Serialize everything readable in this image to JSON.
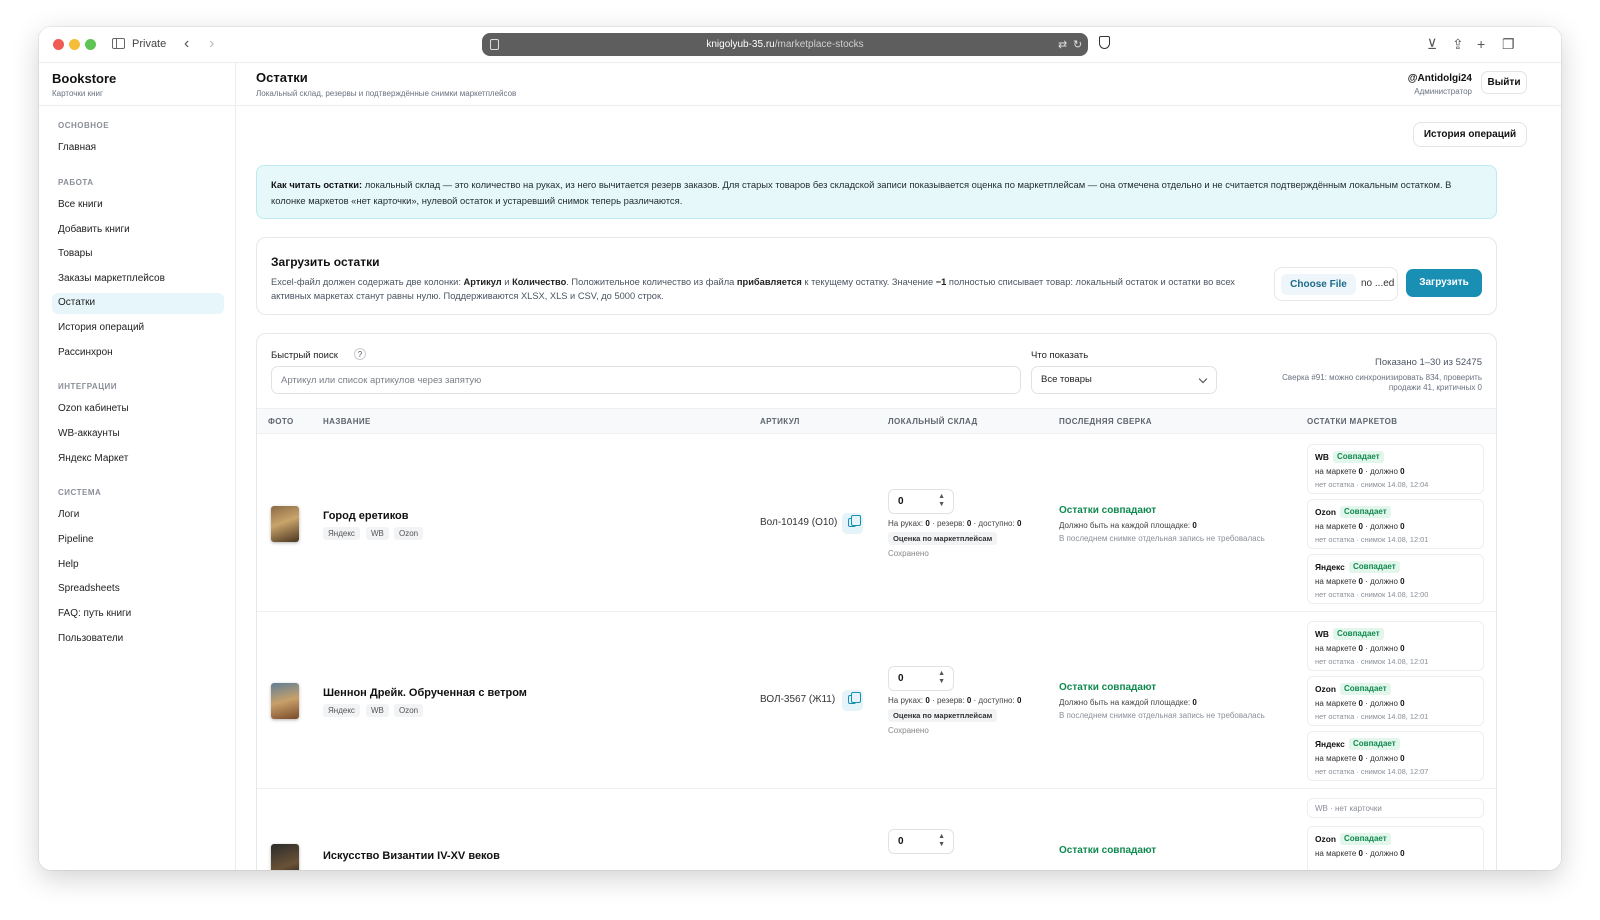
{
  "browser": {
    "private_label": "Private",
    "url_host": "knigolyub-35.ru",
    "url_path": "/marketplace-stocks"
  },
  "sidebar": {
    "brand": "Bookstore",
    "brand_sub": "Карточки книг",
    "sections": [
      {
        "title": "ОСНОВНОЕ",
        "items": [
          "Главная"
        ]
      },
      {
        "title": "РАБОТА",
        "items": [
          "Все книги",
          "Добавить книги",
          "Товары",
          "Заказы маркетплейсов",
          "Остатки",
          "История операций",
          "Рассинхрон"
        ]
      },
      {
        "title": "ИНТЕГРАЦИИ",
        "items": [
          "Ozon кабинеты",
          "WB-аккаунты",
          "Яндекс Маркет"
        ]
      },
      {
        "title": "СИСТЕМА",
        "items": [
          "Логи",
          "Pipeline",
          "Help",
          "Spreadsheets",
          "FAQ: путь книги",
          "Пользователи"
        ]
      }
    ],
    "active_item": "Остатки"
  },
  "header": {
    "title": "Остатки",
    "subtitle": "Локальный склад, резервы и подтверждённые снимки маркетплейсов",
    "user_name": "@Antidolgi24",
    "user_role": "Администратор",
    "logout_label": "Выйти",
    "history_label": "История операций"
  },
  "info": {
    "lead": "Как читать остатки:",
    "text": " локальный склад — это количество на руках, из него вычитается резерв заказов. Для старых товаров без складской записи показывается оценка по маркетплейсам — она отмечена отдельно и не считается подтверждённым локальным остатком. В колонке маркетов «нет карточки», нулевой остаток и устаревший снимок теперь различаются."
  },
  "upload": {
    "title": "Загрузить остатки",
    "desc_parts": [
      "Excel-файл должен содержать две колонки: ",
      "Артикул",
      " и ",
      "Количество",
      ". Положительное количество из файла ",
      "прибавляется",
      " к текущему остатку. Значение ",
      "−1",
      " полностью списывает товар: локальный остаток и остатки во всех активных маркетах станут равны нулю. Поддерживаются XLSX, XLS и CSV, до 5000 строк."
    ],
    "choose_file": "Choose File",
    "file_name": "no ...ed",
    "upload_label": "Загрузить"
  },
  "filters": {
    "search_label": "Быстрый поиск",
    "help": "?",
    "search_placeholder": "Артикул или список артикулов через запятую",
    "show_label": "Что показать",
    "show_value": "Все товары",
    "shown_count": "Показано 1–30 из 52475",
    "sync_note": "Сверка #91: можно синхронизировать 834, проверить продажи 41, критичных 0"
  },
  "table": {
    "columns": [
      "ФОТО",
      "НАЗВАНИЕ",
      "АРТИКУЛ",
      "ЛОКАЛЬНЫЙ СКЛАД",
      "ПОСЛЕДНЯЯ СВЕРКА",
      "ОСТАТКИ МАРКЕТОВ"
    ],
    "rows": [
      {
        "title": "Город еретиков",
        "tags": [
          "Яндекс",
          "WB",
          "Ozon"
        ],
        "sku": "Вол-10149 (О10)",
        "qty": "0",
        "meta": {
          "hands_label": "На руках: ",
          "hands": "0",
          "reserve_label": " · резерв: ",
          "reserve": "0",
          "avail_label": " · доступно: ",
          "avail": "0"
        },
        "estimate": "Оценка по маркетплейсам",
        "saved": "Сохранено",
        "recon_title": "Остатки совпадают",
        "recon_label": "Должно быть на каждой площадке: ",
        "recon_value": "0",
        "recon_note": "В последнем снимке отдельная запись не требовалась",
        "markets": [
          {
            "name": "WB",
            "status": "Совпадает",
            "mk_label": "на маркете ",
            "mk": "0",
            "should_label": " · должно ",
            "should": "0",
            "snap": "нет остатка · снимок 14.08, 12:04"
          },
          {
            "name": "Ozon",
            "status": "Совпадает",
            "mk_label": "на маркете ",
            "mk": "0",
            "should_label": " · должно ",
            "should": "0",
            "snap": "нет остатка · снимок 14.08, 12:01"
          },
          {
            "name": "Яндекс",
            "status": "Совпадает",
            "mk_label": "на маркете ",
            "mk": "0",
            "should_label": " · должно ",
            "should": "0",
            "snap": "нет остатка · снимок 14.08, 12:00"
          }
        ]
      },
      {
        "title": "Шеннон Дрейк. Обрученная с ветром",
        "tags": [
          "Яндекс",
          "WB",
          "Ozon"
        ],
        "sku": "ВОЛ-3567 (Ж11)",
        "qty": "0",
        "meta": {
          "hands_label": "На руках: ",
          "hands": "0",
          "reserve_label": " · резерв: ",
          "reserve": "0",
          "avail_label": " · доступно: ",
          "avail": "0"
        },
        "estimate": "Оценка по маркетплейсам",
        "saved": "Сохранено",
        "recon_title": "Остатки совпадают",
        "recon_label": "Должно быть на каждой площадке: ",
        "recon_value": "0",
        "recon_note": "В последнем снимке отдельная запись не требовалась",
        "markets": [
          {
            "name": "WB",
            "status": "Совпадает",
            "mk_label": "на маркете ",
            "mk": "0",
            "should_label": " · должно ",
            "should": "0",
            "snap": "нет остатка · снимок 14.08, 12:01"
          },
          {
            "name": "Ozon",
            "status": "Совпадает",
            "mk_label": "на маркете ",
            "mk": "0",
            "should_label": " · должно ",
            "should": "0",
            "snap": "нет остатка · снимок 14.08, 12:01"
          },
          {
            "name": "Яндекс",
            "status": "Совпадает",
            "mk_label": "на маркете ",
            "mk": "0",
            "should_label": " · должно ",
            "should": "0",
            "snap": "нет остатка · снимок 14.08, 12:07"
          }
        ]
      },
      {
        "title": "Искусство Византии IV-XV веков",
        "qty": "0",
        "recon_title": "Остатки совпадают",
        "nocard": "WB · нет карточки",
        "markets": [
          {
            "name": "Ozon",
            "status": "Совпадает",
            "mk_label": "на маркете ",
            "mk": "0",
            "should_label": " · должно ",
            "should": "0"
          }
        ]
      }
    ]
  },
  "colors": {
    "accent": "#1a8fb4",
    "success": "#0f8a4f",
    "info_bg": "#e7f8fb"
  }
}
